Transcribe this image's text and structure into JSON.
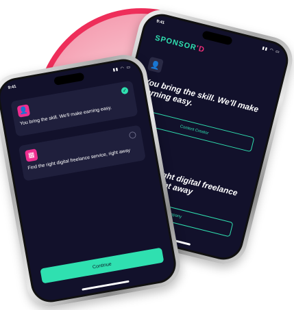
{
  "colors": {
    "accent_teal": "#2fe0b0",
    "accent_pink": "#ee2e90",
    "ring_red": "#ee2e5a",
    "screen_bg": "#12112b"
  },
  "back_phone": {
    "status_time": "9:41",
    "brand_prefix": "SPONSOR",
    "brand_suffix": "'D",
    "section1": {
      "icon": "person-icon",
      "heading": "You bring the skill. We'll make earning easy.",
      "button_label": "Content Creator"
    },
    "section2": {
      "icon": "building-icon",
      "heading": "Find the right digital freelance service, right away",
      "button_label": "Company"
    }
  },
  "front_phone": {
    "status_time": "9:41",
    "cards": [
      {
        "icon": "person-icon",
        "text": "You bring the skill. We'll make earning easy.",
        "checked": true
      },
      {
        "icon": "building-icon",
        "text": "Find the right digital freelance service, right away",
        "checked": false
      }
    ],
    "continue_label": "Continue"
  }
}
